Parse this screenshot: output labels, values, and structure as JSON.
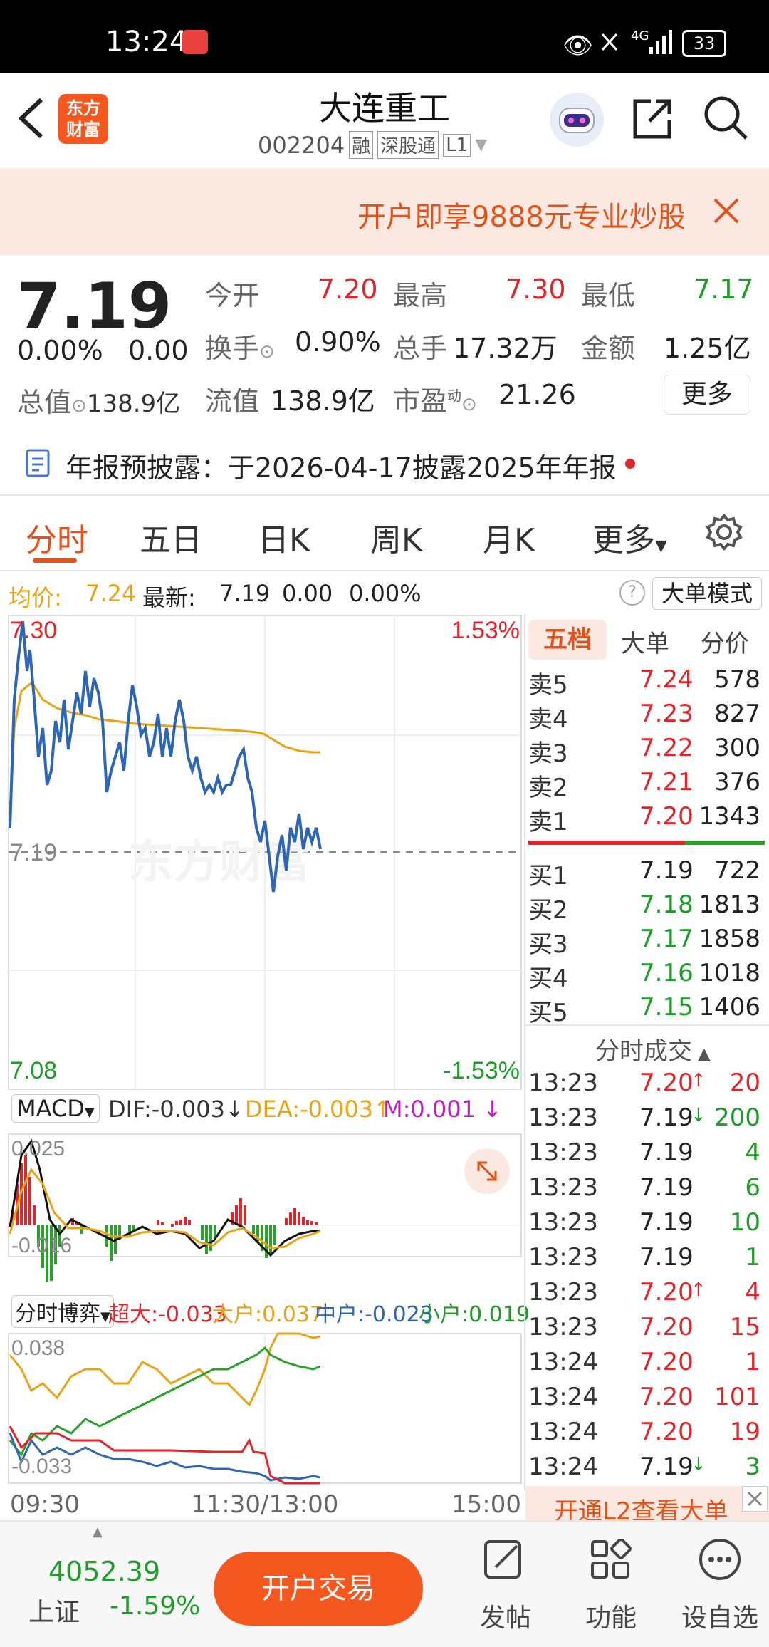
{
  "status": {
    "time": "13:24",
    "network": "4G",
    "battery": "33"
  },
  "header": {
    "title": "大连重工",
    "code": "002204",
    "tags": [
      "融",
      "深股通",
      "L1"
    ],
    "logo_line1": "东方",
    "logo_line2": "财富"
  },
  "banner": {
    "text": "开户即享9888元专业炒股"
  },
  "quote": {
    "price": "7.19",
    "change_pct": "0.00%",
    "change": "0.00",
    "open_label": "今开",
    "open": "7.20",
    "high_label": "最高",
    "high": "7.30",
    "low_label": "最低",
    "low": "7.17",
    "turnover_label": "换手",
    "turnover": "0.90%",
    "volume_label": "总手",
    "volume": "17.32万",
    "amount_label": "金额",
    "amount": "1.25亿",
    "mktcap_label": "总值",
    "mktcap": "138.9亿",
    "float_label": "流值",
    "float": "138.9亿",
    "pe_label": "市盈",
    "pe_sup": "动",
    "pe": "21.26",
    "more": "更多"
  },
  "notice": {
    "text": "年报预披露：于2026-04-17披露2025年年报"
  },
  "tabs": [
    "分时",
    "五日",
    "日K",
    "周K",
    "月K",
    "更多"
  ],
  "info_bar": {
    "avg_label": "均价:",
    "avg": "7.24",
    "latest_label": "最新:",
    "latest": "7.19",
    "chg": "0.00",
    "pct": "0.00%",
    "mode": "大单模式"
  },
  "chart": {
    "top_price": "7.30",
    "top_pct": "1.53%",
    "mid_price": "7.19",
    "bottom_price": "7.08",
    "bottom_pct": "-1.53%",
    "watermark": "东方财富"
  },
  "macd": {
    "selector": "MACD",
    "dif": "DIF:-0.003",
    "dea": "DEA:-0.003",
    "m": "M:0.001",
    "top": "0.025",
    "bottom": "-0.016"
  },
  "game": {
    "selector": "分时博弈",
    "super": "超大:-0.033",
    "big": "大户:0.037",
    "mid": "中户:-0.023",
    "small": "小户:0.019",
    "top": "0.038",
    "bottom": "-0.033"
  },
  "time_axis": [
    "09:30",
    "11:30/13:00",
    "15:00"
  ],
  "side_tabs": [
    "五档",
    "大单",
    "分价"
  ],
  "orderbook": {
    "asks": [
      {
        "label": "卖5",
        "price": "7.24",
        "vol": "578"
      },
      {
        "label": "卖4",
        "price": "7.23",
        "vol": "827"
      },
      {
        "label": "卖3",
        "price": "7.22",
        "vol": "300"
      },
      {
        "label": "卖2",
        "price": "7.21",
        "vol": "376"
      },
      {
        "label": "卖1",
        "price": "7.20",
        "vol": "1343"
      }
    ],
    "bids": [
      {
        "label": "买1",
        "price": "7.19",
        "vol": "722"
      },
      {
        "label": "买2",
        "price": "7.18",
        "vol": "1813"
      },
      {
        "label": "买3",
        "price": "7.17",
        "vol": "1858"
      },
      {
        "label": "买4",
        "price": "7.16",
        "vol": "1018"
      },
      {
        "label": "买5",
        "price": "7.15",
        "vol": "1406"
      }
    ]
  },
  "trades_title": "分时成交",
  "trades": [
    {
      "time": "13:23",
      "price": "7.20",
      "dir": "up",
      "vol": "20"
    },
    {
      "time": "13:23",
      "price": "7.19",
      "dir": "down",
      "vol": "200"
    },
    {
      "time": "13:23",
      "price": "7.19",
      "dir": "",
      "vol": "4"
    },
    {
      "time": "13:23",
      "price": "7.19",
      "dir": "",
      "vol": "6"
    },
    {
      "time": "13:23",
      "price": "7.19",
      "dir": "",
      "vol": "10"
    },
    {
      "time": "13:23",
      "price": "7.19",
      "dir": "",
      "vol": "1"
    },
    {
      "time": "13:23",
      "price": "7.20",
      "dir": "up",
      "vol": "4"
    },
    {
      "time": "13:23",
      "price": "7.20",
      "dir": "",
      "vol": "15"
    },
    {
      "time": "13:24",
      "price": "7.20",
      "dir": "",
      "vol": "1"
    },
    {
      "time": "13:24",
      "price": "7.20",
      "dir": "",
      "vol": "101"
    },
    {
      "time": "13:24",
      "price": "7.20",
      "dir": "",
      "vol": "19"
    },
    {
      "time": "13:24",
      "price": "7.19",
      "dir": "down",
      "vol": "3"
    }
  ],
  "l2_banner": "开通L2查看大单",
  "bottom": {
    "index_value": "4052.39",
    "index_name": "上证",
    "index_pct": "-1.59%",
    "trade_button": "开户交易",
    "nav": [
      "发帖",
      "功能",
      "设自选"
    ]
  },
  "colors": {
    "red": "#e0262d",
    "green": "#1f9c2a",
    "accent": "#ff6a1a",
    "price_line": "#2f66b3",
    "avg_line": "#e8a317"
  }
}
